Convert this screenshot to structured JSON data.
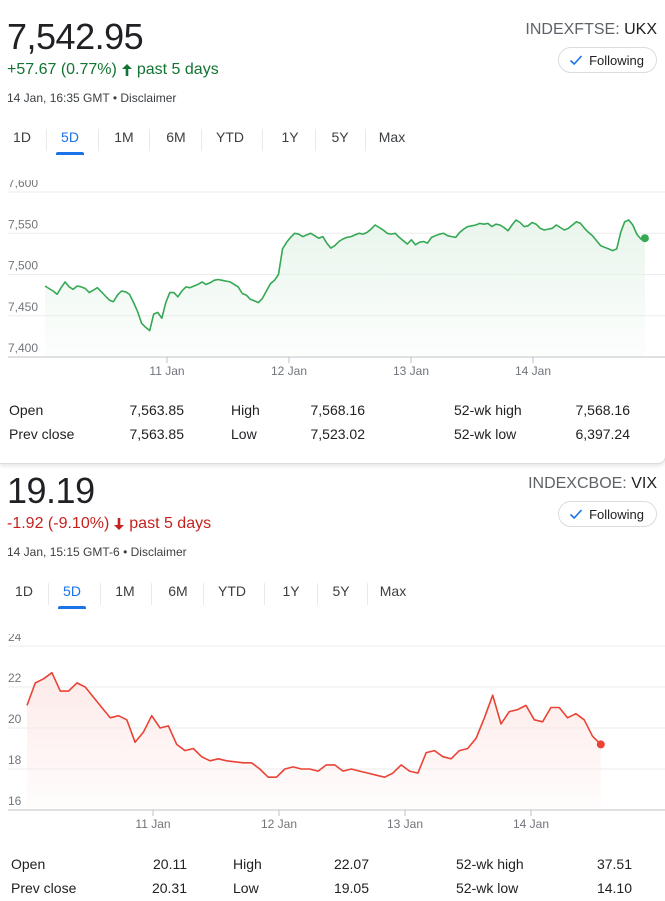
{
  "ftse": {
    "price": "7,542.95",
    "change": "+57.67 (0.77%)",
    "period": "past 5 days",
    "direction": "up",
    "timestamp": "14 Jan, 16:35 GMT",
    "disclaimer": "Disclaimer",
    "exchange": "INDEXFTSE:",
    "symbol": "UKX",
    "follow_label": "Following",
    "tabs": [
      "1D",
      "5D",
      "1M",
      "6M",
      "YTD",
      "1Y",
      "5Y",
      "Max"
    ],
    "active_tab": "5D",
    "stats": {
      "open_label": "Open",
      "open": "7,563.85",
      "prev_close_label": "Prev close",
      "prev_close": "7,563.85",
      "high_label": "High",
      "high": "7,568.16",
      "low_label": "Low",
      "low": "7,523.02",
      "wk52_high_label": "52-wk high",
      "wk52_high": "7,568.16",
      "wk52_low_label": "52-wk low",
      "wk52_low": "6,397.24"
    },
    "chart_data": {
      "type": "area",
      "color": "#34a853",
      "fill": "#e6f4ea",
      "x_tick_labels": [
        "11 Jan",
        "12 Jan",
        "13 Jan",
        "14 Jan"
      ],
      "x_day_start": [
        1,
        2,
        3,
        4
      ],
      "y_tick_labels": [
        "7,600",
        "7,550",
        "7,500",
        "7,450",
        "7,400"
      ],
      "ylim": [
        7400,
        7600
      ],
      "x": [
        0,
        0.033,
        0.066,
        0.099,
        0.132,
        0.165,
        0.198,
        0.231,
        0.264,
        0.297,
        0.33,
        0.363,
        0.396,
        0.429,
        0.462,
        0.495,
        0.528,
        0.561,
        0.594,
        0.627,
        0.66,
        0.693,
        0.726,
        0.759,
        0.792,
        0.825,
        0.858,
        0.891,
        0.924,
        0.957,
        0.99,
        1.023,
        1.056,
        1.089,
        1.122,
        1.155,
        1.188,
        1.221,
        1.254,
        1.287,
        1.32,
        1.353,
        1.386,
        1.419,
        1.452,
        1.485,
        1.518,
        1.551,
        1.584,
        1.617,
        1.65,
        1.683,
        1.716,
        1.749,
        1.782,
        1.815,
        1.848,
        1.881,
        1.914,
        1.947,
        1.98,
        2.013,
        2.046,
        2.079,
        2.112,
        2.145,
        2.178,
        2.211,
        2.244,
        2.277,
        2.31,
        2.343,
        2.376,
        2.409,
        2.442,
        2.475,
        2.508,
        2.541,
        2.574,
        2.607,
        2.64,
        2.673,
        2.706,
        2.739,
        2.772,
        2.805,
        2.838,
        2.871,
        2.904,
        2.937,
        2.97,
        3.003,
        3.036,
        3.069,
        3.102,
        3.135,
        3.168,
        3.201,
        3.234,
        3.267,
        3.3,
        3.333,
        3.366,
        3.399,
        3.432,
        3.465,
        3.498,
        3.531,
        3.564,
        3.597,
        3.63,
        3.663,
        3.696,
        3.729,
        3.762,
        3.795,
        3.828,
        3.861,
        3.894,
        3.927,
        3.96,
        3.993,
        4.026,
        4.059,
        4.092,
        4.125,
        4.158,
        4.191,
        4.224,
        4.257,
        4.29,
        4.323,
        4.356,
        4.389,
        4.422,
        4.455,
        4.488,
        4.521,
        4.554,
        4.587,
        4.62,
        4.653,
        4.686,
        4.719,
        4.752,
        4.785,
        4.818,
        4.851,
        4.884,
        4.917
      ],
      "values": [
        7486,
        7483,
        7480,
        7476,
        7484,
        7491,
        7485,
        7482,
        7486,
        7485,
        7483,
        7478,
        7481,
        7484,
        7479,
        7474,
        7469,
        7467,
        7475,
        7480,
        7479,
        7476,
        7466,
        7455,
        7441,
        7436,
        7432,
        7452,
        7454,
        7447,
        7466,
        7478,
        7478,
        7473,
        7480,
        7485,
        7484,
        7486,
        7488,
        7491,
        7488,
        7490,
        7493,
        7494,
        7493,
        7492,
        7491,
        7488,
        7485,
        7477,
        7475,
        7470,
        7468,
        7466,
        7471,
        7480,
        7489,
        7493,
        7500,
        7531,
        7539,
        7545,
        7550,
        7549,
        7546,
        7548,
        7550,
        7547,
        7544,
        7546,
        7538,
        7532,
        7535,
        7540,
        7543,
        7545,
        7546,
        7548,
        7550,
        7549,
        7551,
        7555,
        7560,
        7557,
        7554,
        7550,
        7549,
        7550,
        7545,
        7541,
        7537,
        7542,
        7536,
        7539,
        7540,
        7538,
        7545,
        7547,
        7549,
        7550,
        7547,
        7546,
        7545,
        7551,
        7555,
        7558,
        7559,
        7560,
        7562,
        7561,
        7562,
        7558,
        7561,
        7560,
        7557,
        7553,
        7560,
        7566,
        7563,
        7558,
        7559,
        7563,
        7561,
        7556,
        7554,
        7555,
        7556,
        7560,
        7557,
        7554,
        7556,
        7560,
        7564,
        7562,
        7556,
        7551,
        7547,
        7541,
        7535,
        7533,
        7531,
        7529,
        7531,
        7551,
        7564,
        7566,
        7560,
        7549,
        7543,
        7544
      ]
    }
  },
  "vix": {
    "price": "19.19",
    "change": "-1.92 (-9.10%)",
    "period": "past 5 days",
    "direction": "down",
    "timestamp": "14 Jan, 15:15 GMT-6",
    "disclaimer": "Disclaimer",
    "exchange": "INDEXCBOE:",
    "symbol": "VIX",
    "follow_label": "Following",
    "tabs": [
      "1D",
      "5D",
      "1M",
      "6M",
      "YTD",
      "1Y",
      "5Y",
      "Max"
    ],
    "active_tab": "5D",
    "stats": {
      "open_label": "Open",
      "open": "20.11",
      "prev_close_label": "Prev close",
      "prev_close": "20.31",
      "high_label": "High",
      "high": "22.07",
      "low_label": "Low",
      "low": "19.05",
      "wk52_high_label": "52-wk high",
      "wk52_high": "37.51",
      "wk52_low_label": "52-wk low",
      "wk52_low": "14.10"
    },
    "chart_data": {
      "type": "area",
      "color": "#ea4335",
      "fill": "#fce8e6",
      "x_tick_labels": [
        "11 Jan",
        "12 Jan",
        "13 Jan",
        "14 Jan"
      ],
      "x_day_start": [
        1,
        2,
        3,
        4
      ],
      "y_tick_labels": [
        "24",
        "22",
        "20",
        "18",
        "16"
      ],
      "ylim": [
        16,
        24
      ],
      "x": [
        0,
        0.066,
        0.132,
        0.198,
        0.264,
        0.33,
        0.396,
        0.462,
        0.528,
        0.594,
        0.66,
        0.726,
        0.792,
        0.858,
        0.924,
        0.99,
        1.056,
        1.122,
        1.188,
        1.254,
        1.32,
        1.386,
        1.452,
        1.518,
        1.584,
        1.65,
        1.716,
        1.782,
        1.848,
        1.914,
        1.98,
        2.046,
        2.112,
        2.178,
        2.244,
        2.31,
        2.376,
        2.442,
        2.508,
        2.574,
        2.64,
        2.706,
        2.772,
        2.838,
        2.904,
        2.97,
        3.036,
        3.102,
        3.168,
        3.234,
        3.3,
        3.366,
        3.432,
        3.498,
        3.564,
        3.63,
        3.696,
        3.762,
        3.828,
        3.894,
        3.96,
        4.026,
        4.092,
        4.158,
        4.224,
        4.29,
        4.356,
        4.422,
        4.488,
        4.554,
        4.62,
        4.686,
        4.752,
        4.818,
        4.884,
        4.95
      ],
      "values": [
        21.1,
        22.2,
        22.4,
        22.7,
        21.8,
        21.8,
        22.2,
        22.0,
        21.5,
        21.0,
        20.5,
        20.6,
        20.4,
        19.3,
        19.8,
        20.6,
        20.0,
        20.1,
        19.2,
        18.9,
        19.0,
        18.6,
        18.4,
        18.5,
        18.4,
        18.35,
        18.3,
        18.3,
        18.0,
        17.6,
        17.6,
        18.0,
        18.1,
        18.0,
        18.0,
        17.9,
        18.2,
        18.2,
        17.9,
        18.0,
        17.9,
        17.8,
        17.7,
        17.6,
        17.8,
        18.2,
        17.9,
        17.8,
        18.8,
        18.9,
        18.6,
        18.5,
        18.9,
        19.0,
        19.5,
        20.5,
        21.6,
        20.2,
        20.8,
        20.9,
        21.1,
        20.4,
        20.3,
        21.0,
        21.0,
        20.5,
        20.7,
        20.4,
        19.6,
        19.2
      ]
    }
  }
}
